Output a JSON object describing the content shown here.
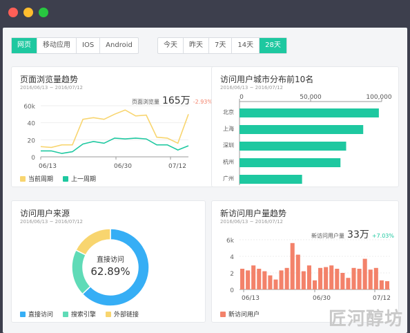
{
  "window": {
    "controls": [
      {
        "name": "close",
        "color": "#ff5f57"
      },
      {
        "name": "minimize",
        "color": "#ffbd2e"
      },
      {
        "name": "maximize",
        "color": "#28c840"
      }
    ]
  },
  "platform_tabs": [
    "网页",
    "移动应用",
    "IOS",
    "Android"
  ],
  "platform_active": 0,
  "range_tabs": [
    "今天",
    "昨天",
    "7天",
    "14天",
    "28天"
  ],
  "range_active": 4,
  "colors": {
    "accent": "#1ec8a0",
    "yellow": "#f8d56f",
    "orange": "#f3826a",
    "blue": "#36aef5",
    "green": "#5fdbb7"
  },
  "card_pv": {
    "title": "页面浏览量趋势",
    "date": "2016/06/13 ~ 2016/07/12",
    "metric_label": "页面浏览量",
    "metric_value": "165万",
    "metric_change": "-2.93%",
    "legend": [
      "当前周期",
      "上一周期"
    ]
  },
  "card_city": {
    "title": "访问用户城市分布前10名",
    "date": "2016/06/13 ~ 2016/07/12"
  },
  "card_source": {
    "title": "访问用户来源",
    "date": "2016/06/13 ~ 2016/07/12",
    "center_label": "直接访问",
    "center_value": "62.89%",
    "legend": [
      "直接访问",
      "搜索引擎",
      "外部链接"
    ]
  },
  "card_new": {
    "title": "新访问用户量趋势",
    "date": "2016/06/13 ~ 2016/07/12",
    "metric_label": "新访问用户量",
    "metric_value": "33万",
    "metric_change": "+7.03%",
    "legend": [
      "新访问用户"
    ]
  },
  "watermark": "匠河醇坊",
  "chart_data": [
    {
      "type": "line",
      "title": "页面浏览量趋势",
      "x_ticks": [
        "06/13",
        "06/30",
        "07/12"
      ],
      "y_ticks": [
        "60k",
        "40",
        "20",
        "0"
      ],
      "ylim": [
        0,
        60
      ],
      "series": [
        {
          "name": "当前周期",
          "values": [
            12,
            11,
            14,
            14,
            44,
            46,
            44,
            50,
            55,
            48,
            49,
            23,
            22,
            16,
            50
          ]
        },
        {
          "name": "上一周期",
          "values": [
            7,
            7,
            4,
            6,
            15,
            18,
            16,
            22,
            21,
            22,
            21,
            14,
            14,
            8,
            13
          ]
        }
      ]
    },
    {
      "type": "bar",
      "title": "访问用户城市分布前10名",
      "orientation": "horizontal",
      "categories": [
        "北京",
        "上海",
        "深圳",
        "杭州",
        "广州"
      ],
      "values": [
        98000,
        87000,
        75000,
        71000,
        44000
      ],
      "x_ticks": [
        "0",
        "50,000",
        "100,000"
      ],
      "xlim": [
        0,
        100000
      ]
    },
    {
      "type": "pie",
      "title": "访问用户来源",
      "categories": [
        "直接访问",
        "搜索引擎",
        "外部链接"
      ],
      "values": [
        62.89,
        19.5,
        17.61
      ]
    },
    {
      "type": "bar",
      "title": "新访问用户量趋势",
      "categories_ticks": [
        "06/13",
        "06/30",
        "07/12"
      ],
      "y_ticks": [
        "6k",
        "4",
        "2",
        "0"
      ],
      "ylim": [
        0,
        6
      ],
      "series": [
        {
          "name": "新访问用户",
          "values": [
            2.5,
            2.3,
            2.9,
            2.5,
            2.2,
            1.7,
            1.2,
            2.3,
            2.6,
            5.6,
            4.2,
            2.2,
            2.9,
            1.1,
            2.6,
            2.7,
            2.9,
            2.5,
            2.0,
            1.4,
            2.6,
            2.5,
            3.7,
            2.4,
            2.6,
            1.1,
            1.0
          ]
        }
      ]
    }
  ]
}
